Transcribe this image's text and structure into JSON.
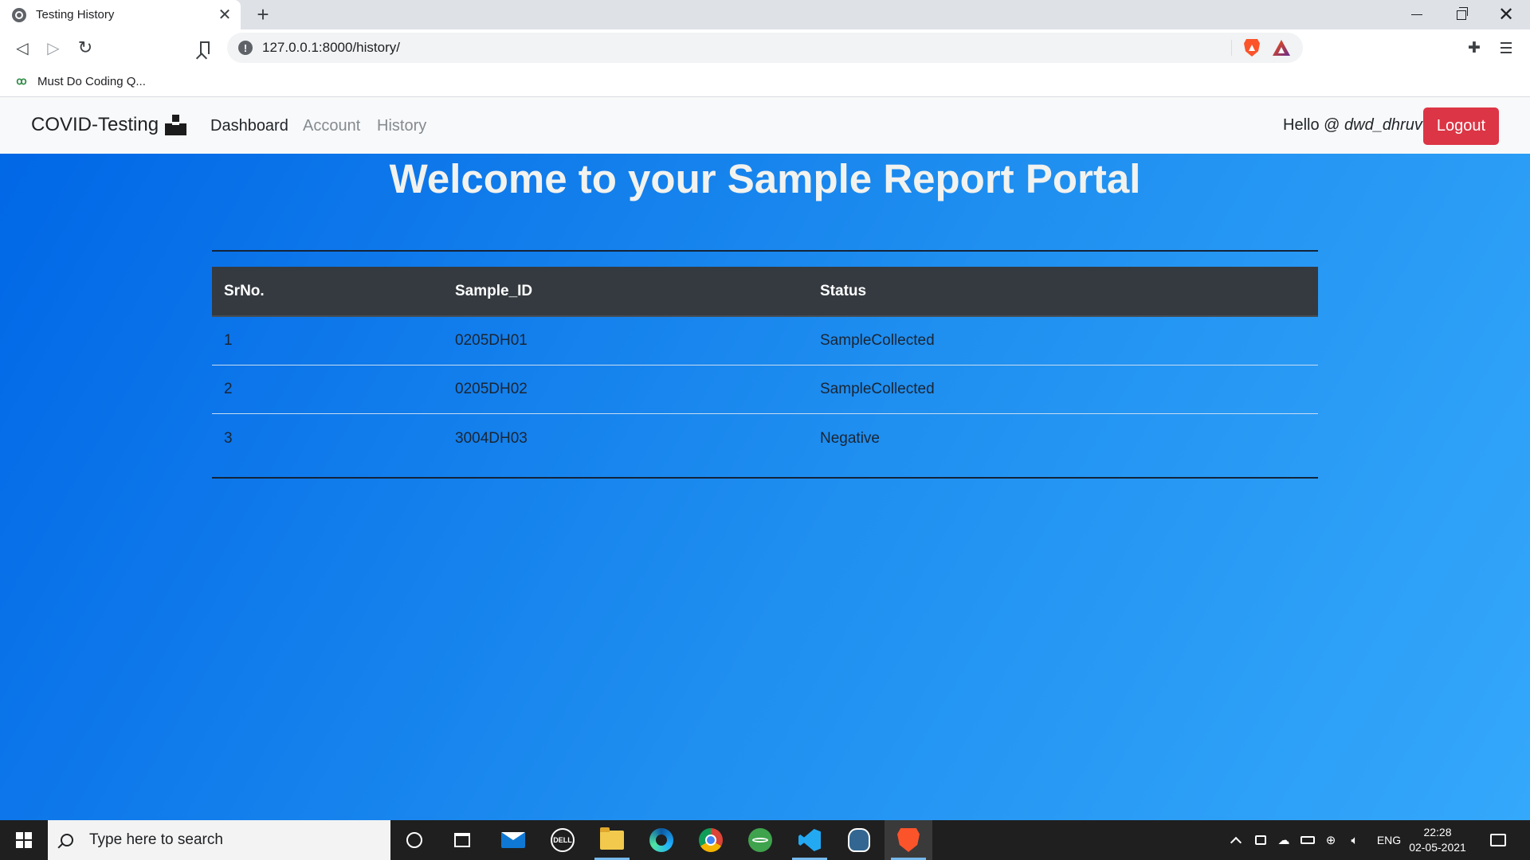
{
  "browser": {
    "tab_title": "Testing History",
    "url": "127.0.0.1:8000/history/",
    "bookmark_label": "Must Do Coding Q..."
  },
  "navbar": {
    "brand": "COVID-Testing",
    "links": [
      "Dashboard",
      "Account",
      "History"
    ],
    "hello_prefix": "Hello @",
    "username": "dwd_dhruv",
    "logout_label": "Logout"
  },
  "page": {
    "heading": "Welcome to your Sample Report Portal"
  },
  "table": {
    "headers": [
      "SrNo.",
      "Sample_ID",
      "Status"
    ],
    "rows": [
      [
        "1",
        "0205DH01",
        "SampleCollected"
      ],
      [
        "2",
        "0205DH02",
        "SampleCollected"
      ],
      [
        "3",
        "3004DH03",
        "Negative"
      ]
    ]
  },
  "taskbar": {
    "search_placeholder": "Type here to search",
    "dell_text": "DELL",
    "language": "ENG",
    "time": "22:28",
    "date": "02-05-2021"
  },
  "colors": {
    "page_gradient_start": "#0066e6",
    "page_gradient_end": "#34a8fb",
    "table_header_bg": "#343a40",
    "logout_bg": "#dc3545",
    "heading_color": "#f2f2ef"
  },
  "icons": {
    "tab_favicon": "globe-icon",
    "tab_close": "close-icon",
    "new_tab": "plus-icon",
    "back": "back-arrow-icon",
    "forward": "forward-arrow-icon",
    "reload": "reload-icon",
    "bookmark": "bookmark-icon",
    "site_info": "info-icon",
    "brave_shields": "brave-shield-icon",
    "rewards": "bat-rewards-icon",
    "extensions": "puzzle-icon",
    "menu": "hamburger-menu-icon",
    "brand": "building-blocks-icon"
  }
}
